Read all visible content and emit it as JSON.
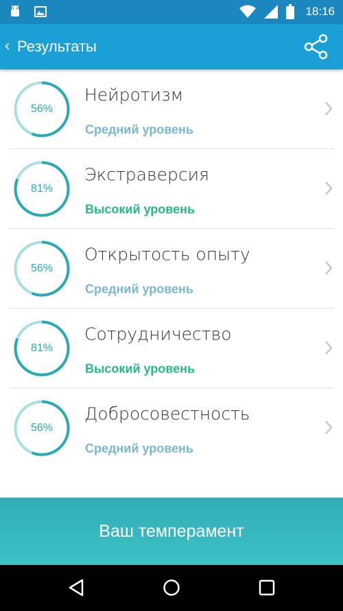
{
  "status_bar": {
    "time": "18:16",
    "icons": [
      "android-icon",
      "image-icon",
      "wifi-icon",
      "signal-icon",
      "battery-icon"
    ]
  },
  "app_bar": {
    "title": "Результаты",
    "back_icon": "back-chevron-icon",
    "share_icon": "share-icon"
  },
  "results": [
    {
      "percent_label": "56%",
      "value": 56,
      "name": "Нейротизм",
      "level": "Средний уровень",
      "level_color": "#7bb8cf"
    },
    {
      "percent_label": "81%",
      "value": 81,
      "name": "Экстраверсия",
      "level": "Высокий уровень",
      "level_color": "#25b88a"
    },
    {
      "percent_label": "56%",
      "value": 56,
      "name": "Открытость опыту",
      "level": "Средний уровень",
      "level_color": "#7bb8cf"
    },
    {
      "percent_label": "81%",
      "value": 81,
      "name": "Сотрудничество",
      "level": "Высокий уровень",
      "level_color": "#25b88a"
    },
    {
      "percent_label": "56%",
      "value": 56,
      "name": "Добросовестность",
      "level": "Средний уровень",
      "level_color": "#7bb8cf"
    }
  ],
  "bottom_button": {
    "label": "Ваш темперамент"
  },
  "nav_bar": {
    "icons": [
      "back-triangle-icon",
      "home-circle-icon",
      "recents-square-icon"
    ]
  },
  "colors": {
    "status_bar": "#1a87bf",
    "app_bar": "#1ba0d6",
    "ring_light": "#a8dfe2",
    "ring_dark": "#2aa9b3",
    "bottom_button": "#36b7bd"
  }
}
